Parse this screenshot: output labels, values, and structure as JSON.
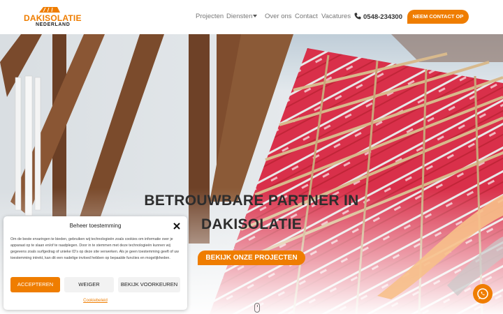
{
  "brand": {
    "name": "DAKISOLATIE",
    "sub": "NEDERLAND",
    "accent": "#ef7d00",
    "dark": "#2d2d2d"
  },
  "nav": {
    "items": [
      "Projecten",
      "Diensten",
      "Over ons",
      "Contact",
      "Vacatures"
    ],
    "phone": "0548-234300",
    "cta": "NEEM CONTACT OP"
  },
  "hero": {
    "title_line1": "BETROUWBARE PARTNER IN",
    "title_line2": "DAKISOLATIE",
    "cta": "BEKIJK ONZE PROJECTEN"
  },
  "cookie": {
    "title": "Beheer toestemming",
    "text": "Om de beste ervaringen te bieden, gebruiken wij technologieën zoals cookies om informatie over je apparaat op te slaan en/of te raadplegen. Door in te stemmen met deze technologieën kunnen wij gegevens zoals surfgedrag of unieke ID's op deze site verwerken. Als je geen toestemming geeft of uw toestemming intrekt, kan dit een nadelige invloed hebben op bepaalde functies en mogelijkheden.",
    "accept": "ACCEPTEREN",
    "deny": "WEIGER",
    "preferences": "BEKIJK VOORKEUREN",
    "policy_link": "Cookiebeleid"
  },
  "icons": [
    "phone-icon",
    "close-icon",
    "whatsapp-icon",
    "chevron-down-icon",
    "scroll-down-icon"
  ]
}
